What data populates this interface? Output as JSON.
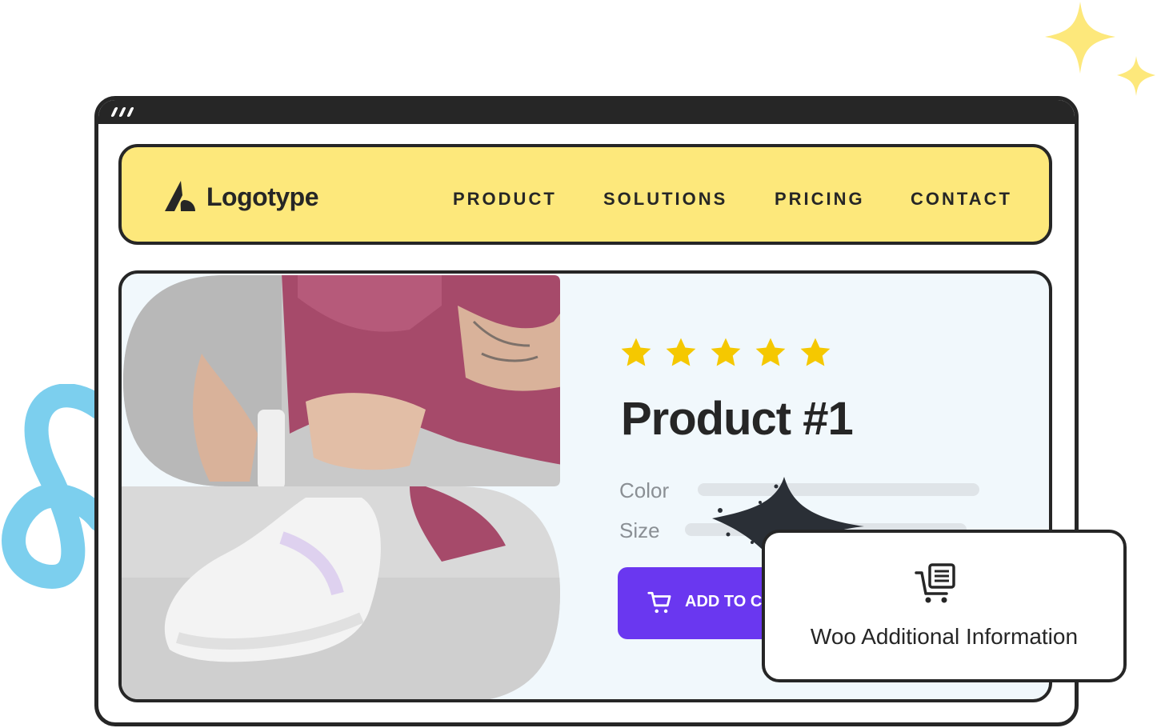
{
  "nav": {
    "logo_text": "Logotype",
    "items": [
      {
        "label": "PRODUCT"
      },
      {
        "label": "SOLUTIONS"
      },
      {
        "label": "PRICING"
      },
      {
        "label": "CONTACT"
      }
    ]
  },
  "product": {
    "rating": 5,
    "rating_max": 5,
    "title": "Product #1",
    "color_label": "Color",
    "size_label": "Size",
    "add_button_label": "ADD TO CART",
    "image_icon": "sneaker-photo"
  },
  "info_card": {
    "icon": "cart-list-icon",
    "label": "Woo Additional Information"
  },
  "colors": {
    "navbar_bg": "#fde87b",
    "card_bg": "#f1f8fc",
    "accent": "#6a37f0",
    "star": "#f5c800",
    "outline": "#262626",
    "squiggle": "#7ccfee",
    "sparkle": "#fde87b"
  }
}
